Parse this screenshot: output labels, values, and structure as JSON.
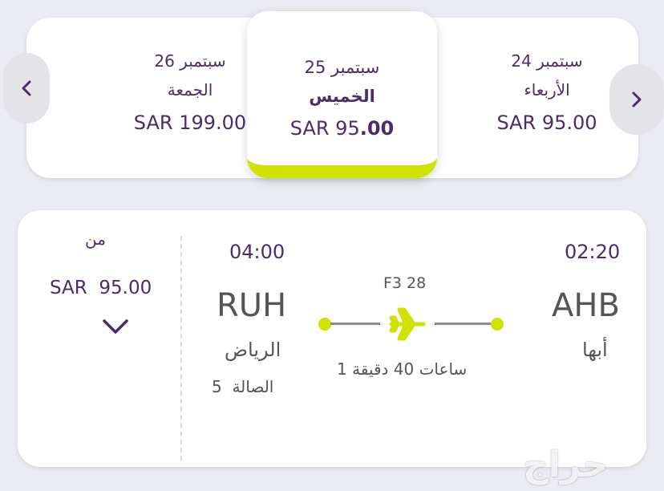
{
  "date_strip": {
    "left_day": {
      "date": "26 سبتمبر",
      "weekday": "الجمعة",
      "price": "SAR 199.00"
    },
    "selected_day": {
      "date": "25 سبتمبر",
      "weekday": "الخميس",
      "price_prefix": "SAR 95",
      "price_suffix": ".00"
    },
    "right_day": {
      "date": "24 سبتمبر",
      "weekday": "الأربعاء",
      "price": "SAR 95.00"
    },
    "prev_icon": "chevron-left-icon",
    "next_icon": "chevron-right-icon",
    "accent_color": "#cfe200"
  },
  "flight": {
    "price_label": "من",
    "currency": "SAR",
    "amount": "95.00",
    "expand_icon": "chevron-down-icon",
    "arrival_time": "04:00",
    "arrival_code": "RUH",
    "arrival_city": "الرياض",
    "terminal_label": "الصالة",
    "terminal_number": "5",
    "flight_number": "F3 28",
    "duration": "1 ساعات 40 دقيقة",
    "plane_icon": "airplane-icon",
    "departure_time": "02:20",
    "departure_code": "AHB",
    "departure_city": "أبها"
  },
  "watermark": "حراج",
  "colors": {
    "primary": "#4b2c69",
    "accent": "#cfe200",
    "background": "#ebebf3"
  }
}
